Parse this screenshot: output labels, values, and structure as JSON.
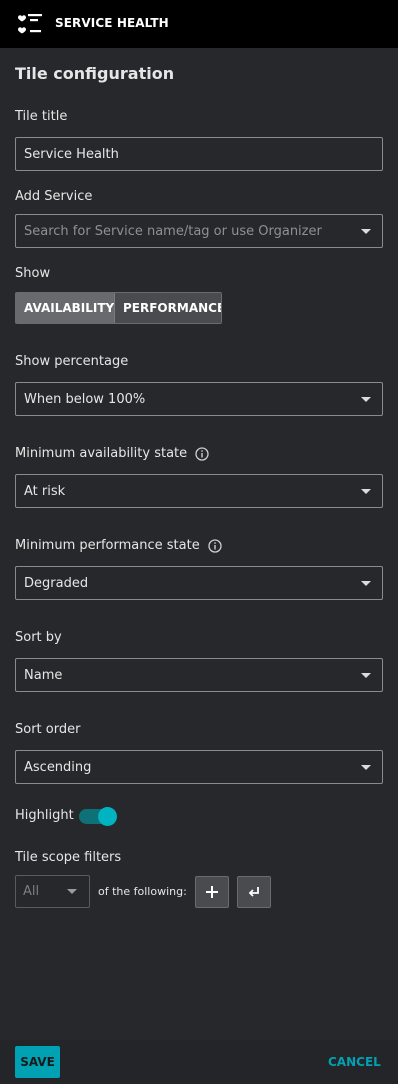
{
  "header": {
    "title": "SERVICE HEALTH",
    "logo_icon": "service-health-icon"
  },
  "panel": {
    "title": "Tile configuration"
  },
  "tile_title": {
    "label": "Tile title",
    "value": "Service Health"
  },
  "add_service": {
    "label": "Add Service",
    "placeholder": "Search for Service name/tag or use Organizer"
  },
  "show": {
    "label": "Show",
    "options": [
      "AVAILABILITY",
      "PERFORMANCE"
    ],
    "selected": "AVAILABILITY"
  },
  "show_percentage": {
    "label": "Show percentage",
    "value": "When below 100%"
  },
  "min_availability": {
    "label": "Minimum availability state",
    "value": "At risk"
  },
  "min_performance": {
    "label": "Minimum performance state",
    "value": "Degraded"
  },
  "sort_by": {
    "label": "Sort by",
    "value": "Name"
  },
  "sort_order": {
    "label": "Sort order",
    "value": "Ascending"
  },
  "highlight": {
    "label": "Highlight",
    "enabled": true
  },
  "scope_filters": {
    "label": "Tile scope filters",
    "match_value": "All",
    "text": "of the following:"
  },
  "footer": {
    "save_label": "SAVE",
    "cancel_label": "CANCEL"
  },
  "colors": {
    "accent": "#00a1b2",
    "background": "#27282b",
    "header": "#000000"
  }
}
